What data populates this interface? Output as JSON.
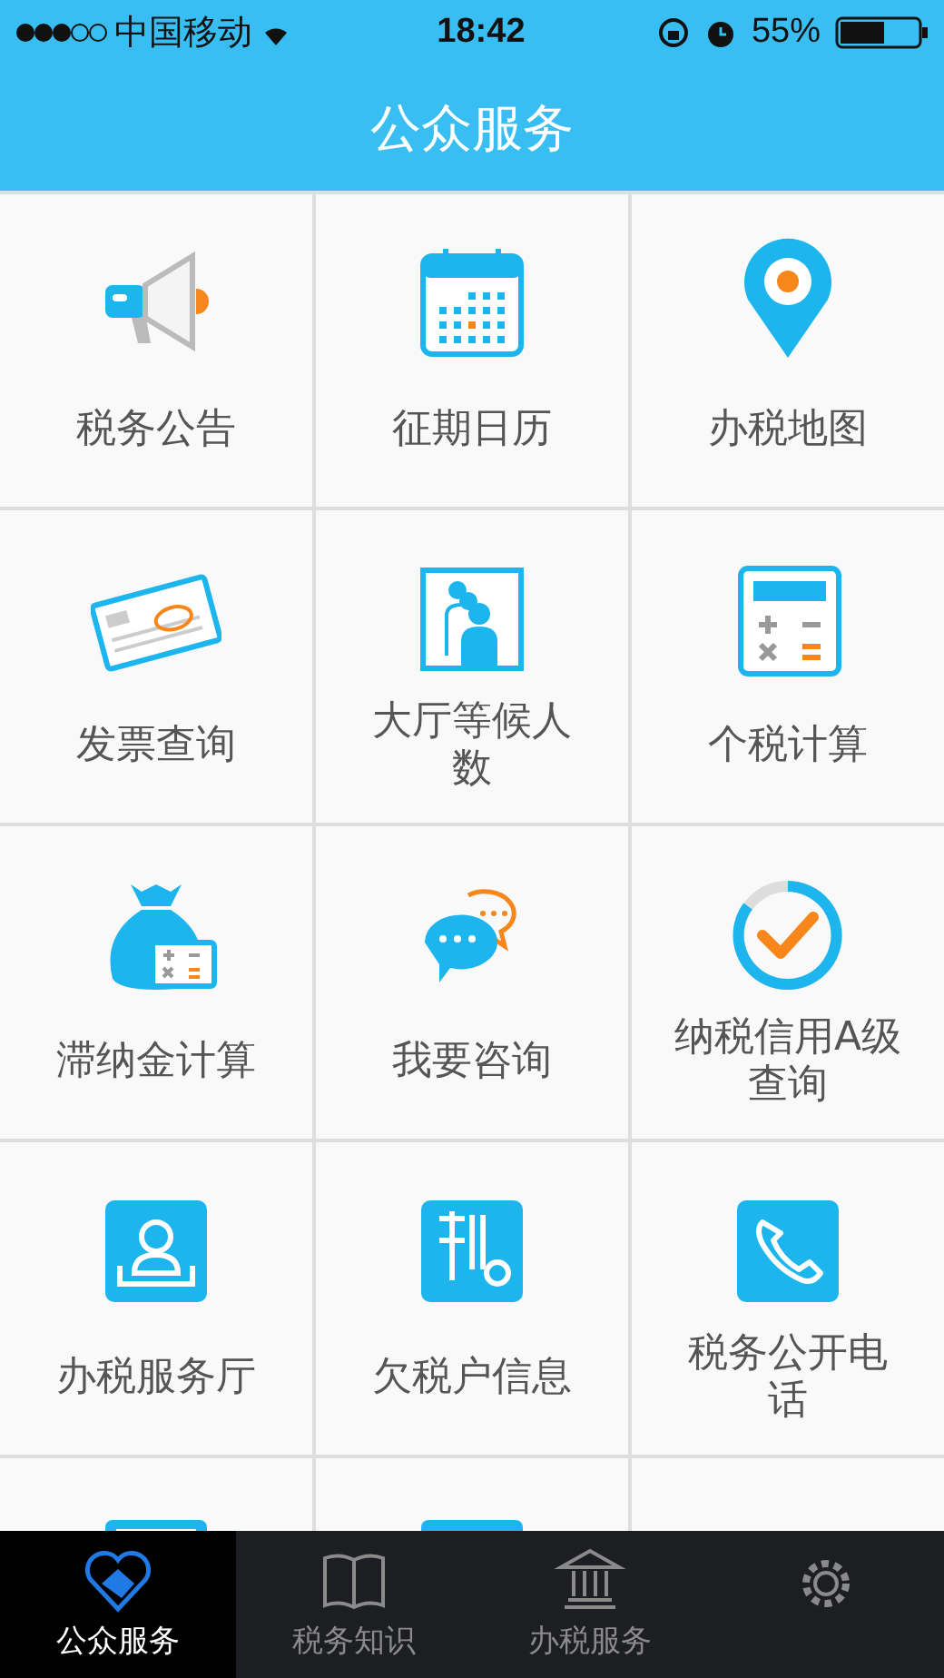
{
  "status_bar": {
    "carrier": "中国移动",
    "time": "18:42",
    "battery": "55%"
  },
  "header": {
    "title": "公众服务"
  },
  "services": [
    {
      "label": "税务公告"
    },
    {
      "label": "征期日历"
    },
    {
      "label": "办税地图"
    },
    {
      "label": "发票查询"
    },
    {
      "label": "大厅等候人数"
    },
    {
      "label": "个税计算"
    },
    {
      "label": "滞纳金计算"
    },
    {
      "label": "我要咨询"
    },
    {
      "label": "纳税信用A级查询"
    },
    {
      "label": "办税服务厅"
    },
    {
      "label": "欠税户信息"
    },
    {
      "label": "税务公开电话"
    }
  ],
  "tabs": [
    {
      "label": "公众服务",
      "selected": true
    },
    {
      "label": "税务知识",
      "selected": false
    },
    {
      "label": "办税服务",
      "selected": false
    },
    {
      "selected": false
    }
  ]
}
